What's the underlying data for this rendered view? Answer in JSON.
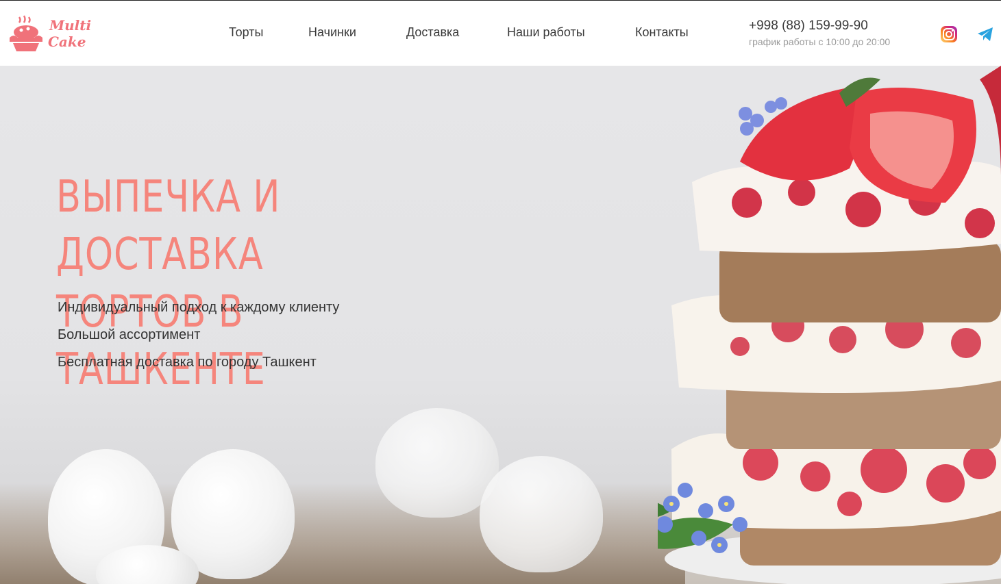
{
  "brand": {
    "logo_line1": "Multi",
    "logo_line2": "Cake",
    "accent": "#f0727a"
  },
  "nav": {
    "items": [
      {
        "label": "Торты"
      },
      {
        "label": "Начинки"
      },
      {
        "label": "Доставка"
      },
      {
        "label": "Наши работы"
      },
      {
        "label": "Контакты"
      }
    ]
  },
  "contact": {
    "phone": "+998 (88) 159-99-90",
    "hours": "график работы с 10:00 до 20:00"
  },
  "social": {
    "icons": [
      "instagram-icon",
      "telegram-icon"
    ]
  },
  "hero": {
    "title_line1": "ВЫПЕЧКА И ДОСТАВКА",
    "title_line2": "ТОРТОВ В ТАШКЕНТЕ",
    "title_color": "#f5857c",
    "features": [
      "Индивидуальный подход к каждому клиенту",
      "Большой ассортимент",
      "Бесплатная доставка по городу Ташкент"
    ]
  }
}
